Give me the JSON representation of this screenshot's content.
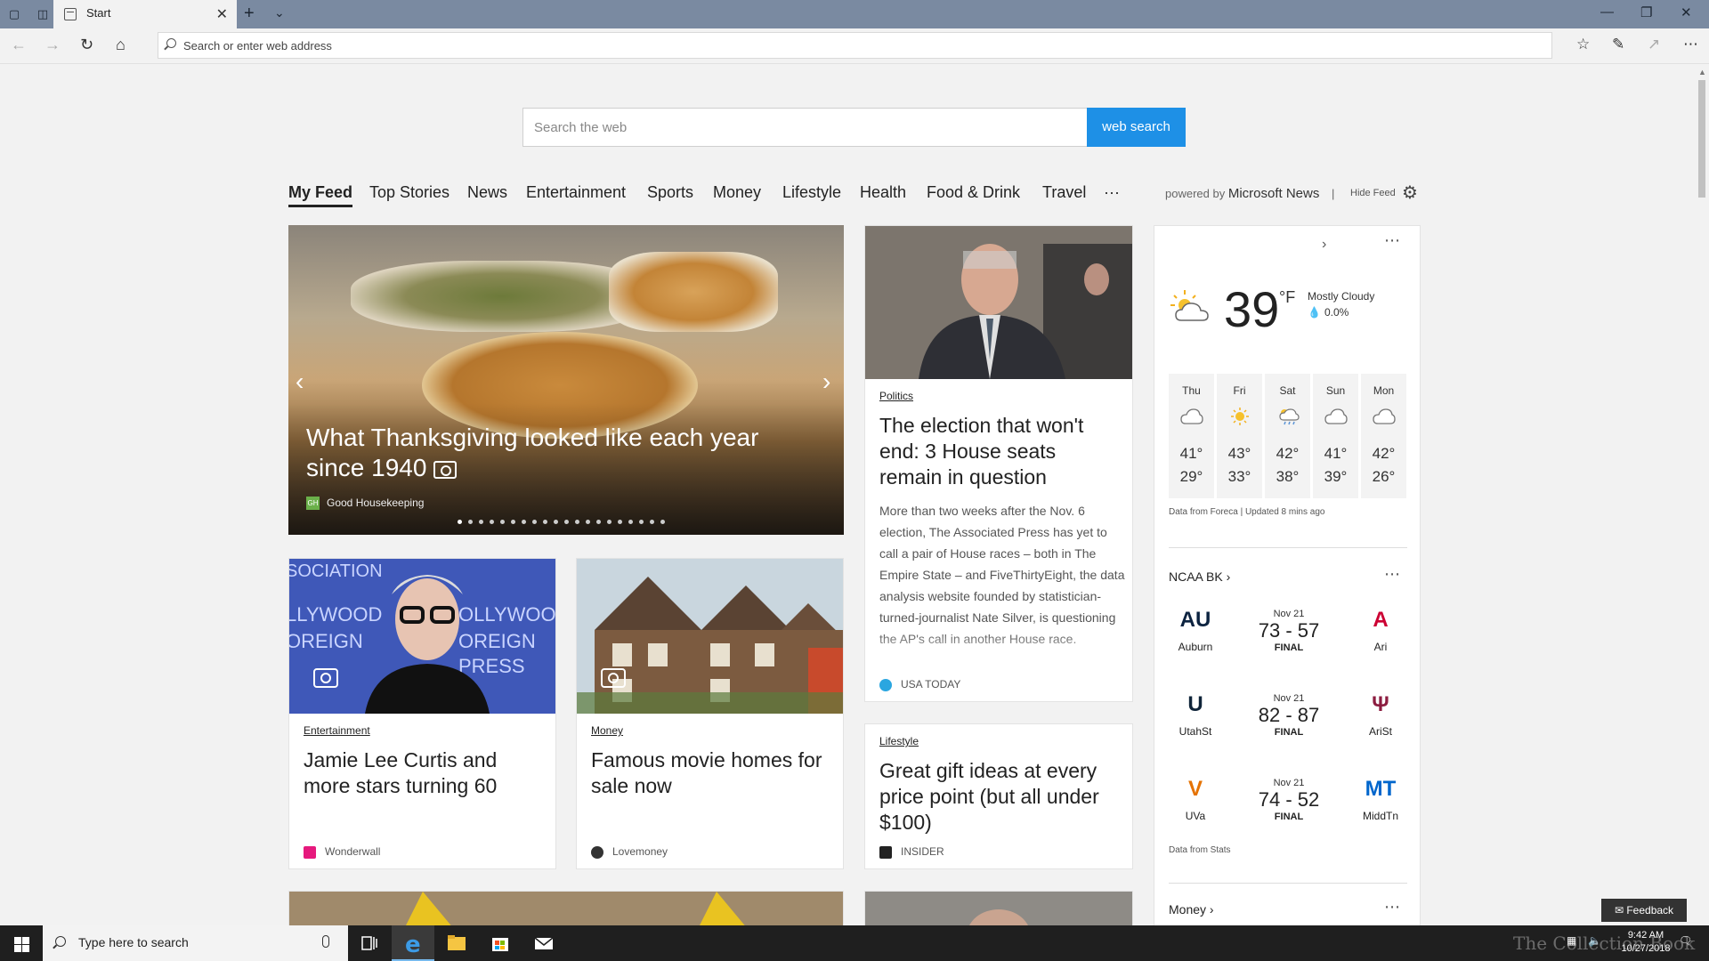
{
  "browser": {
    "tab_title": "Start",
    "address_placeholder": "Search or enter web address"
  },
  "search": {
    "placeholder": "Search the web",
    "button": "web search"
  },
  "feed_tabs": [
    "My Feed",
    "Top Stories",
    "News",
    "Entertainment",
    "Sports",
    "Money",
    "Lifestyle",
    "Health",
    "Food & Drink",
    "Travel",
    "···"
  ],
  "powered": {
    "prefix": "powered by",
    "brand": "Microsoft News",
    "sep": "|",
    "hide": "Hide Feed"
  },
  "hero": {
    "headline": "What Thanksgiving looked like each year since 1940",
    "source": "Good Housekeeping",
    "source_logo": "GH",
    "slides": 20,
    "current_slide": 1
  },
  "articles": {
    "politics": {
      "category": "Politics",
      "title": "The election that won't end: 3 House seats remain in question",
      "body": "More than two weeks after the Nov. 6 election, The Associated Press has yet to call a pair of House races – both in The Empire State – and FiveThirtyEight, the data analysis website founded by statistician-turned-journalist Nate Silver, is questioning the AP's call in another House race.",
      "source": "USA TODAY"
    },
    "entertainment": {
      "category": "Entertainment",
      "title": "Jamie Lee Curtis and more stars turning 60",
      "source": "Wonderwall"
    },
    "money": {
      "category": "Money",
      "title": "Famous movie homes for sale now",
      "source": "Lovemoney"
    },
    "lifestyle": {
      "category": "Lifestyle",
      "title": "Great gift ideas at every price point (but all under $100)",
      "source": "INSIDER"
    }
  },
  "weather": {
    "temp": "39",
    "unit": "°F",
    "condition": "Mostly Cloudy",
    "precip": "0.0%",
    "forecast": [
      {
        "day": "Thu",
        "icon": "cloud-icon",
        "hi": "41°",
        "lo": "29°"
      },
      {
        "day": "Fri",
        "icon": "sun-icon",
        "hi": "43°",
        "lo": "33°"
      },
      {
        "day": "Sat",
        "icon": "sun-rain-icon",
        "hi": "42°",
        "lo": "38°"
      },
      {
        "day": "Sun",
        "icon": "cloud-icon",
        "hi": "41°",
        "lo": "39°"
      },
      {
        "day": "Mon",
        "icon": "cloud-icon",
        "hi": "42°",
        "lo": "26°"
      }
    ],
    "source": "Data from Foreca | Updated 8 mins ago"
  },
  "ncaa": {
    "title": "NCAA BK",
    "games": [
      {
        "home": "Auburn",
        "away": "Ari",
        "date": "Nov 21",
        "score": "73 - 57",
        "status": "FINAL",
        "home_color": "#0c2340",
        "away_color": "#cc0033"
      },
      {
        "home": "UtahSt",
        "away": "AriSt",
        "date": "Nov 21",
        "score": "82 - 87",
        "status": "FINAL",
        "home_color": "#0f2439",
        "away_color": "#8c1d40"
      },
      {
        "home": "UVa",
        "away": "MiddTn",
        "date": "Nov 21",
        "score": "74 - 52",
        "status": "FINAL",
        "home_color": "#e57200",
        "away_color": "#0066cc"
      }
    ],
    "source": "Data from Stats"
  },
  "money_section": {
    "title": "Money"
  },
  "feedback": "Feedback",
  "taskbar": {
    "search_placeholder": "Type here to search",
    "time": "9:42 AM",
    "date": "10/27/2018"
  },
  "watermark": "The Collection Book",
  "colors": {
    "accent": "#1e90e6",
    "taskbar": "#1f1f1f",
    "titlebar": "#7a8aa1"
  }
}
